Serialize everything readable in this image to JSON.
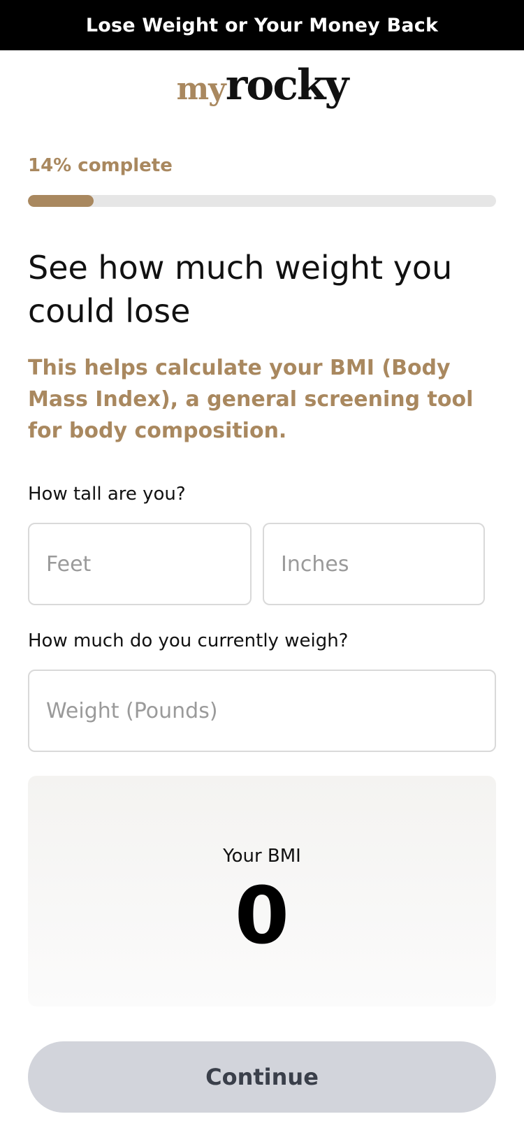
{
  "banner": {
    "text": "Lose Weight or Your Money Back"
  },
  "logo": {
    "prefix": "my",
    "name": "rocky"
  },
  "progress": {
    "label": "14% complete",
    "percent": 14
  },
  "heading": "See how much weight you could lose",
  "subtext": "This helps calculate your BMI (Body Mass Index), a general screening tool for body composition.",
  "height_question": {
    "label": "How tall are you?",
    "feet_placeholder": "Feet",
    "inches_placeholder": "Inches"
  },
  "weight_question": {
    "label": "How much do you currently weigh?",
    "weight_placeholder": "Weight (Pounds)"
  },
  "bmi": {
    "label": "Your BMI",
    "value": "0"
  },
  "continue_label": "Continue",
  "colors": {
    "accent": "#a9885f",
    "banner_bg": "#000000",
    "button_bg": "#d2d4db"
  }
}
